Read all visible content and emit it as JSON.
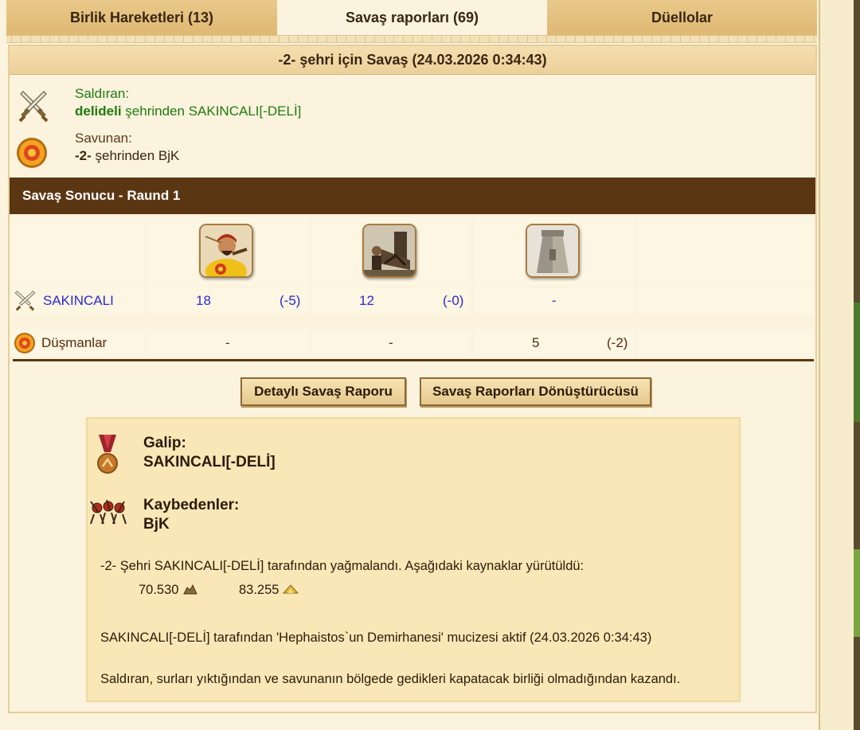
{
  "tabs": [
    {
      "label": "Birlik Hareketleri (13)"
    },
    {
      "label": "Savaş raporları (69)"
    },
    {
      "label": "Düellolar"
    }
  ],
  "report": {
    "title": "-2- şehri için Savaş (24.03.2026 0:34:43)",
    "attacker": {
      "role": "Saldıran:",
      "city": "delideli",
      "suffix": " şehrinden SAKINCALI[-DELİ]"
    },
    "defender": {
      "role": "Savunan:",
      "city": "-2-",
      "suffix": " şehrinden BjK"
    },
    "round_title": "Savaş Sonucu - Raund 1",
    "rows": [
      {
        "name": "SAKINCALI",
        "cells": [
          {
            "count": "18",
            "loss": "(-5)"
          },
          {
            "count": "12",
            "loss": "(-0)"
          },
          {
            "count": "-",
            "loss": ""
          }
        ]
      },
      {
        "name": "Düşmanlar",
        "cells": [
          {
            "count": "-",
            "loss": ""
          },
          {
            "count": "-",
            "loss": ""
          },
          {
            "count": "5",
            "loss": "(-2)"
          }
        ]
      }
    ],
    "buttons": {
      "detail": "Detaylı Savaş Raporu",
      "converter": "Savaş Raporları Dönüştürücüsü"
    }
  },
  "result": {
    "winner_label": "Galip:",
    "winner_name": "SAKINCALI[-DELİ]",
    "loser_label": "Kaybedenler:",
    "loser_name": "BjK",
    "plunder_text": "-2- Şehri SAKINCALI[-DELİ] tarafından yağmalandı. Aşağıdaki kaynaklar yürütüldü:",
    "resource_1": "70.530",
    "resource_2": "83.255",
    "wonder_text": "SAKINCALI[-DELİ] tarafından 'Hephaistos`un Demirhanesi' mucizesi aktif (24.03.2026 0:34:43)",
    "outcome_text": "Saldıran, surları yıktığından ve savunanın bölgede gedikleri kapatacak birliği olmadığından kazandı."
  },
  "icons": [
    "crossed-swords-icon",
    "shield-icon",
    "warrior-unit-icon",
    "catapult-unit-icon",
    "tower-unit-icon",
    "medal-icon",
    "fallen-army-icon",
    "stone-icon",
    "gold-icon"
  ],
  "colors": {
    "accent_dark": "#5b3613",
    "attacker_green": "#1f7a10",
    "unit_blue": "#2b2ad0",
    "background": "#fbf3dd"
  }
}
